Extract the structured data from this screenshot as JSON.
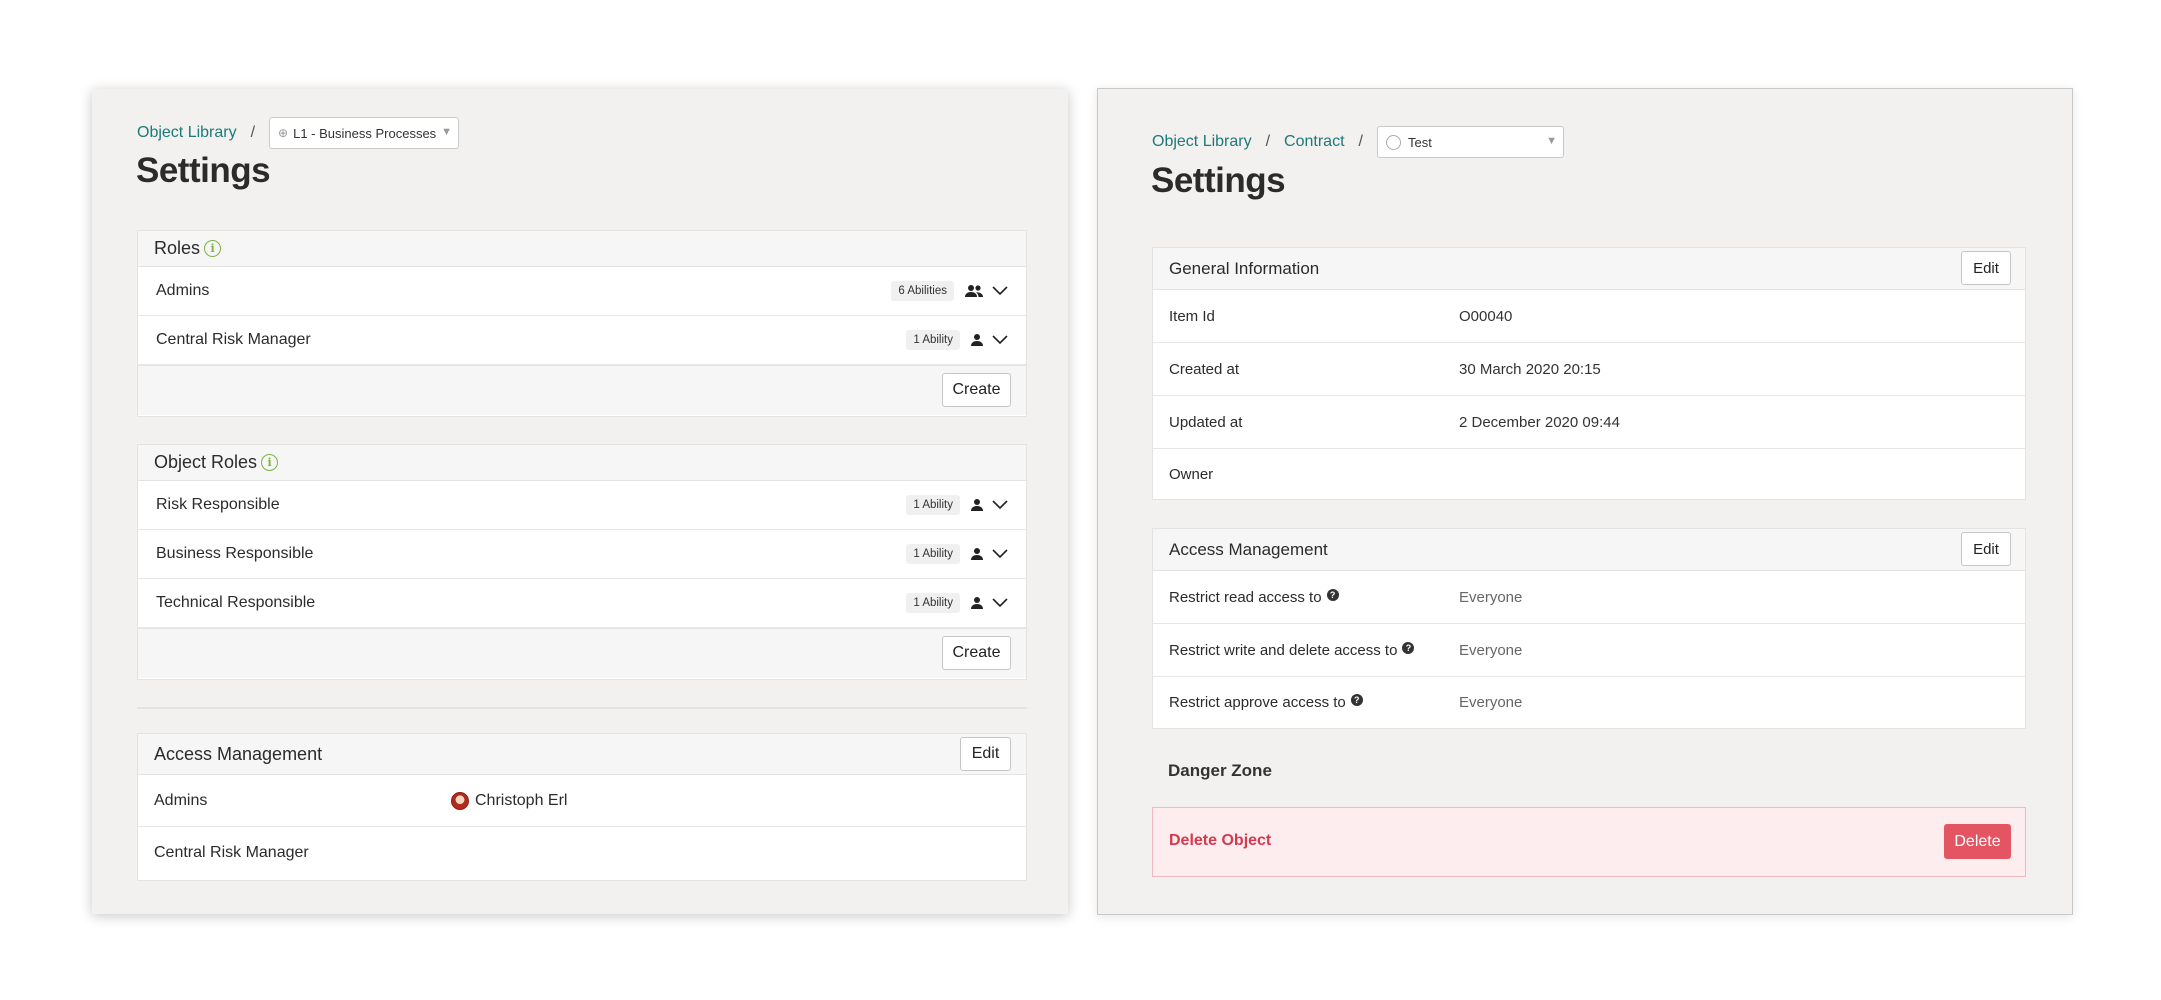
{
  "left": {
    "breadcrumb": {
      "link": "Object Library",
      "sep": "/",
      "select_value": "L1 - Business Processes"
    },
    "title": "Settings",
    "roles": {
      "heading": "Roles",
      "items": [
        {
          "name": "Admins",
          "badge": "6 Abilities",
          "icon": "people-icon"
        },
        {
          "name": "Central Risk Manager",
          "badge": "1 Ability",
          "icon": "person-icon"
        }
      ],
      "create_label": "Create"
    },
    "object_roles": {
      "heading": "Object Roles",
      "items": [
        {
          "name": "Risk Responsible",
          "badge": "1 Ability",
          "icon": "person-icon"
        },
        {
          "name": "Business Responsible",
          "badge": "1 Ability",
          "icon": "person-icon"
        },
        {
          "name": "Technical Responsible",
          "badge": "1 Ability",
          "icon": "person-icon"
        }
      ],
      "create_label": "Create"
    },
    "access": {
      "heading": "Access Management",
      "edit_label": "Edit",
      "rows": [
        {
          "role": "Admins",
          "member": "Christoph Erl"
        },
        {
          "role": "Central Risk Manager",
          "member": ""
        }
      ]
    }
  },
  "right": {
    "breadcrumb": {
      "link1": "Object Library",
      "link2": "Contract",
      "sep": "/",
      "select_value": "Test"
    },
    "title": "Settings",
    "general": {
      "heading": "General Information",
      "edit_label": "Edit",
      "rows": [
        {
          "label": "Item Id",
          "value": "O00040"
        },
        {
          "label": "Created at",
          "value": "30 March 2020 20:15"
        },
        {
          "label": "Updated at",
          "value": "2 December 2020 09:44"
        },
        {
          "label": "Owner",
          "value": ""
        }
      ]
    },
    "access": {
      "heading": "Access Management",
      "edit_label": "Edit",
      "rows": [
        {
          "label": "Restrict read access to",
          "value": "Everyone"
        },
        {
          "label": "Restrict write and delete access to",
          "value": "Everyone"
        },
        {
          "label": "Restrict approve access to",
          "value": "Everyone"
        }
      ]
    },
    "danger": {
      "title": "Danger Zone",
      "label": "Delete Object",
      "button": "Delete"
    }
  },
  "colors": {
    "link": "#1c7a78",
    "info_green": "#7cb342",
    "danger": "#e35563",
    "panel_bg": "#f2f1ef"
  }
}
